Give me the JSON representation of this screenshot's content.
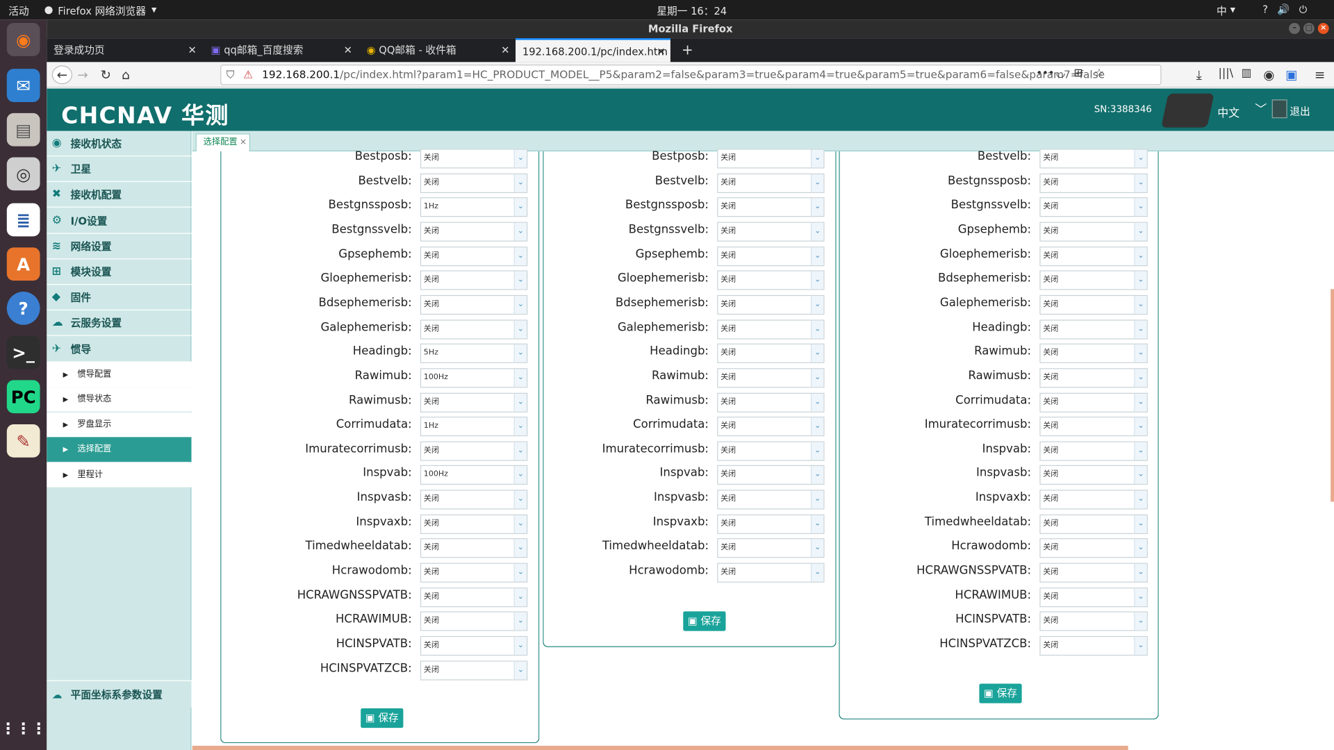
{
  "system": {
    "activities": "活动",
    "app_menu": "Firefox 网络浏览器",
    "clock": "星期一 16：24",
    "ime": "中",
    "indicators": [
      "?",
      "🔊",
      "⏻"
    ]
  },
  "window": {
    "title": "Mozilla Firefox"
  },
  "tabs": [
    {
      "label": "登录成功页"
    },
    {
      "label": "qq邮箱_百度搜索"
    },
    {
      "label": "QQ邮箱 - 收件箱"
    },
    {
      "label": "192.168.200.1/pc/index.htm"
    }
  ],
  "url": {
    "host": "192.168.200.1",
    "path": "/pc/index.html?param1=HC_PRODUCT_MODEL__P5&param2=false&param3=true&param4=true&param5=true&param6=false&param7=false"
  },
  "header": {
    "brand": "CHCNAV 华测",
    "sn": "SN:3388346",
    "language": "中文",
    "logout": "退出"
  },
  "sidebar": {
    "items": [
      {
        "label": "接收机状态",
        "icon": "dashboard-icon"
      },
      {
        "label": "卫星",
        "icon": "satellite-icon"
      },
      {
        "label": "接收机配置",
        "icon": "tools-icon"
      },
      {
        "label": "I/O设置",
        "icon": "gear-icon"
      },
      {
        "label": "网络设置",
        "icon": "wifi-icon"
      },
      {
        "label": "模块设置",
        "icon": "modules-icon"
      },
      {
        "label": "固件",
        "icon": "layers-icon"
      },
      {
        "label": "云服务设置",
        "icon": "cloud-icon"
      },
      {
        "label": "惯导",
        "icon": "plane-icon"
      }
    ],
    "subitems": [
      {
        "label": "惯导配置"
      },
      {
        "label": "惯导状态"
      },
      {
        "label": "罗盘显示"
      },
      {
        "label": "选择配置"
      },
      {
        "label": "里程计"
      }
    ],
    "bottom": "平面坐标系参数设置"
  },
  "page_tab": {
    "label": "选择配置"
  },
  "save_label": "保存",
  "columns": [
    {
      "rows": [
        [
          "Bestposb:",
          "关闭"
        ],
        [
          "Bestvelb:",
          "关闭"
        ],
        [
          "Bestgnssposb:",
          "1Hz"
        ],
        [
          "Bestgnssvelb:",
          "关闭"
        ],
        [
          "Gpsephemb:",
          "关闭"
        ],
        [
          "Gloephemerisb:",
          "关闭"
        ],
        [
          "Bdsephemerisb:",
          "关闭"
        ],
        [
          "Galephemerisb:",
          "关闭"
        ],
        [
          "Headingb:",
          "5Hz"
        ],
        [
          "Rawimub:",
          "100Hz"
        ],
        [
          "Rawimusb:",
          "关闭"
        ],
        [
          "Corrimudata:",
          "1Hz"
        ],
        [
          "Imuratecorrimusb:",
          "关闭"
        ],
        [
          "Inspvab:",
          "100Hz"
        ],
        [
          "Inspvasb:",
          "关闭"
        ],
        [
          "Inspvaxb:",
          "关闭"
        ],
        [
          "Timedwheeldatab:",
          "关闭"
        ],
        [
          "Hcrawodomb:",
          "关闭"
        ],
        [
          "HCRAWGNSSPVATB:",
          "关闭"
        ],
        [
          "HCRAWIMUB:",
          "关闭"
        ],
        [
          "HCINSPVATB:",
          "关闭"
        ],
        [
          "HCINSPVATZCB:",
          "关闭"
        ]
      ]
    },
    {
      "rows": [
        [
          "Bestposb:",
          "关闭"
        ],
        [
          "Bestvelb:",
          "关闭"
        ],
        [
          "Bestgnssposb:",
          "关闭"
        ],
        [
          "Bestgnssvelb:",
          "关闭"
        ],
        [
          "Gpsephemb:",
          "关闭"
        ],
        [
          "Gloephemerisb:",
          "关闭"
        ],
        [
          "Bdsephemerisb:",
          "关闭"
        ],
        [
          "Galephemerisb:",
          "关闭"
        ],
        [
          "Headingb:",
          "关闭"
        ],
        [
          "Rawimub:",
          "关闭"
        ],
        [
          "Rawimusb:",
          "关闭"
        ],
        [
          "Corrimudata:",
          "关闭"
        ],
        [
          "Imuratecorrimusb:",
          "关闭"
        ],
        [
          "Inspvab:",
          "关闭"
        ],
        [
          "Inspvasb:",
          "关闭"
        ],
        [
          "Inspvaxb:",
          "关闭"
        ],
        [
          "Timedwheeldatab:",
          "关闭"
        ],
        [
          "Hcrawodomb:",
          "关闭"
        ]
      ]
    },
    {
      "rows": [
        [
          "Bestvelb:",
          "关闭"
        ],
        [
          "Bestgnssposb:",
          "关闭"
        ],
        [
          "Bestgnssvelb:",
          "关闭"
        ],
        [
          "Gpsephemb:",
          "关闭"
        ],
        [
          "Gloephemerisb:",
          "关闭"
        ],
        [
          "Bdsephemerisb:",
          "关闭"
        ],
        [
          "Galephemerisb:",
          "关闭"
        ],
        [
          "Headingb:",
          "关闭"
        ],
        [
          "Rawimub:",
          "关闭"
        ],
        [
          "Rawimusb:",
          "关闭"
        ],
        [
          "Corrimudata:",
          "关闭"
        ],
        [
          "Imuratecorrimusb:",
          "关闭"
        ],
        [
          "Inspvab:",
          "关闭"
        ],
        [
          "Inspvasb:",
          "关闭"
        ],
        [
          "Inspvaxb:",
          "关闭"
        ],
        [
          "Timedwheeldatab:",
          "关闭"
        ],
        [
          "Hcrawodomb:",
          "关闭"
        ],
        [
          "HCRAWGNSSPVATB:",
          "关闭"
        ],
        [
          "HCRAWIMUB:",
          "关闭"
        ],
        [
          "HCINSPVATB:",
          "关闭"
        ],
        [
          "HCINSPVATZCB:",
          "关闭"
        ]
      ]
    }
  ],
  "colors": {
    "header": "#106e6c",
    "sidebar": "#cfe8e7",
    "accent": "#1aa39a"
  }
}
